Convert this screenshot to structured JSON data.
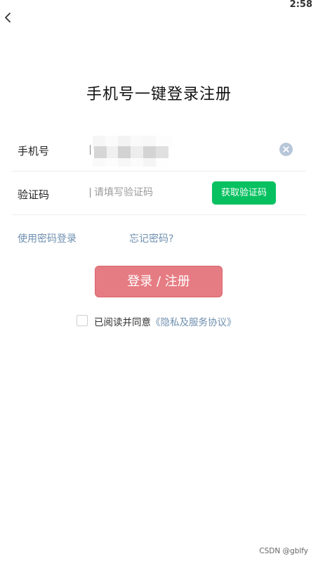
{
  "status_bar": {
    "time": "2:58"
  },
  "nav": {
    "back_icon": "chevron-left-icon"
  },
  "title": "手机号一键登录注册",
  "phone": {
    "label": "手机号",
    "clear_icon": "clear-circle-icon"
  },
  "code": {
    "label": "验证码",
    "placeholder": "请填写验证码",
    "get_code_label": "获取验证码"
  },
  "links": {
    "password_login": "使用密码登录",
    "forgot_password": "忘记密码?"
  },
  "submit_label": "登录 / 注册",
  "agreement": {
    "prefix": "已阅读并同意",
    "policy_link": "《隐私及服务协议》",
    "checked": false
  },
  "watermark": "CSDN @gblfy",
  "colors": {
    "accent_green": "#07c160",
    "submit_pink": "#e67c83",
    "link_blue": "#6f8faf",
    "clear_gray": "#b8c6d9"
  }
}
